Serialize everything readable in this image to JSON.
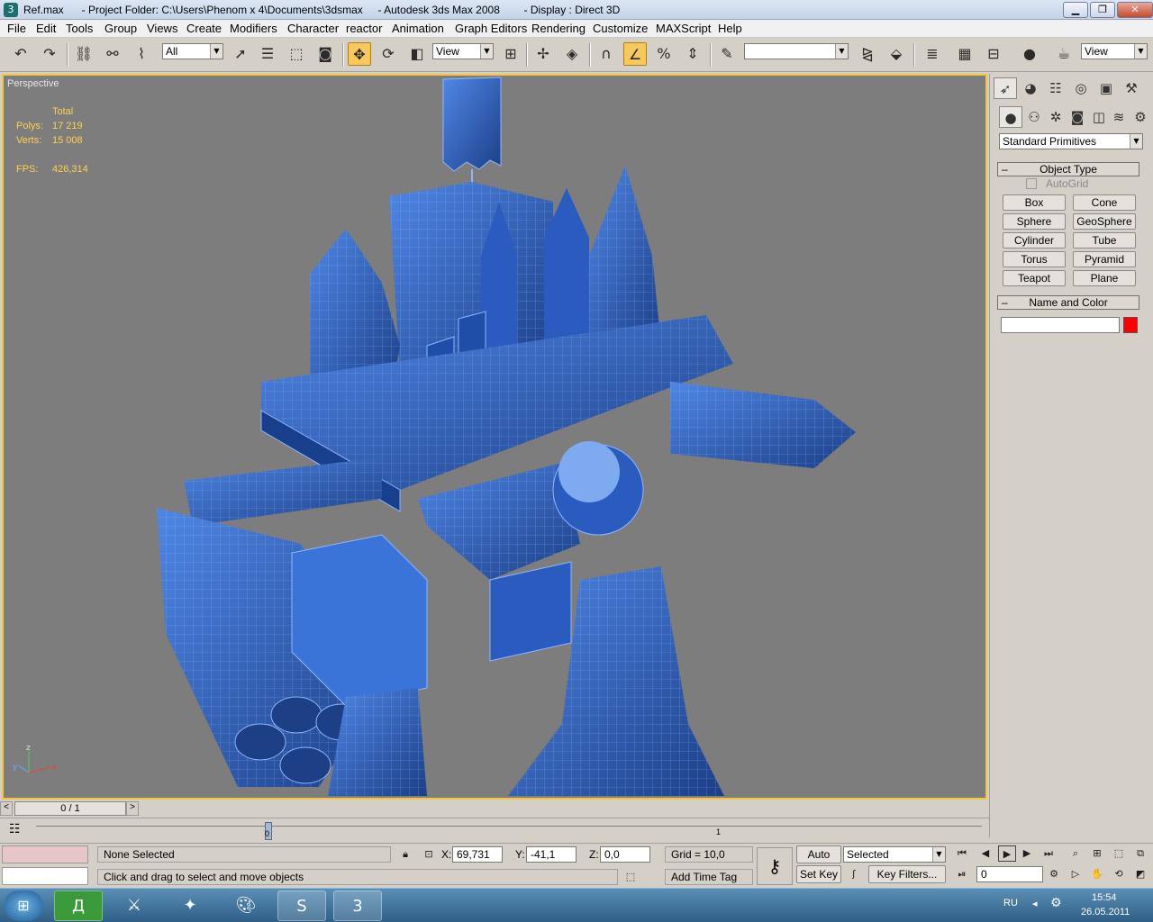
{
  "window": {
    "title": "Ref.max      - Project Folder: C:\\Users\\Phenom x 4\\Documents\\3dsmax     - Autodesk 3ds Max 2008        - Display : Direct 3D",
    "app_icon": "3dsmax-icon"
  },
  "menu": [
    "File",
    "Edit",
    "Tools",
    "Group",
    "Views",
    "Create",
    "Modifiers",
    "Character",
    "reactor",
    "Animation",
    "Graph Editors",
    "Rendering",
    "Customize",
    "MAXScript",
    "Help"
  ],
  "toolbar": {
    "selection_filter": "All",
    "reference_coord": "View",
    "named_selection": "",
    "view_dropdown": "View"
  },
  "viewport": {
    "label": "Perspective",
    "stats": {
      "total_label": "Total",
      "polys_label": "Polys:",
      "polys_value": "17 219",
      "verts_label": "Verts:",
      "verts_value": "15 008",
      "fps_label": "FPS:",
      "fps_value": "426,314"
    },
    "axis": {
      "x": "x",
      "y": "y",
      "z": "z"
    }
  },
  "command_panel": {
    "category_dropdown": "Standard Primitives",
    "object_type": {
      "title": "Object Type",
      "autogrid": "AutoGrid",
      "buttons": [
        "Box",
        "Cone",
        "Sphere",
        "GeoSphere",
        "Cylinder",
        "Tube",
        "Torus",
        "Pyramid",
        "Teapot",
        "Plane"
      ]
    },
    "name_and_color": {
      "title": "Name and Color",
      "name_value": "",
      "color": "#ff0000"
    }
  },
  "time_slider": {
    "frame_label": "0 / 1",
    "prev": "<",
    "next": ">",
    "tick_start": "0",
    "tick_end": "1"
  },
  "status": {
    "selection_text": "None Selected",
    "prompt_text": "Click and drag to select and move objects",
    "x_label": "X:",
    "x_value": "69,731",
    "y_label": "Y:",
    "y_value": "-41,1",
    "z_label": "Z:",
    "z_value": "0,0",
    "grid_text": "Grid = 10,0",
    "add_time_tag": "Add Time Tag",
    "auto_key": "Auto Key",
    "set_key": "Set Key",
    "key_mode": "Selected",
    "key_filters": "Key Filters...",
    "current_frame": "0"
  },
  "taskbar": {
    "lang": "RU",
    "time": "15:54",
    "date": "26.05.2011"
  }
}
